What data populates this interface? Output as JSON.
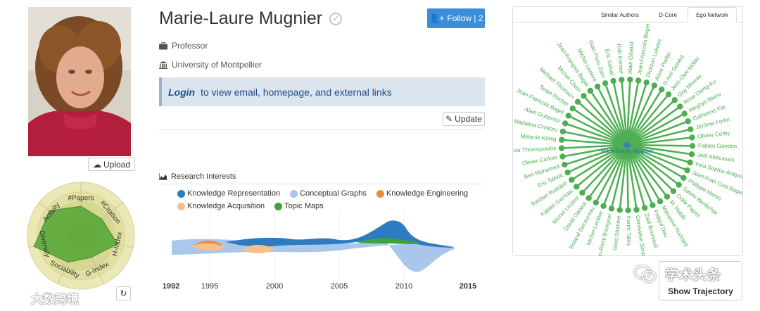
{
  "profile": {
    "name": "Marie-Laure Mugnier",
    "position": "Professor",
    "affiliation": "University of Montpellier",
    "upload_label": "Upload",
    "follow_label": "Follow | 2",
    "login_text": "Login",
    "login_suffix": "to view email, homepage, and external links",
    "update_label": "Update"
  },
  "radar": {
    "axes": [
      "#Papers",
      "#Citation",
      "H-Index",
      "G-Index",
      "Sociability",
      "Diversity",
      "Activity"
    ],
    "values": [
      0.55,
      0.5,
      0.7,
      0.45,
      0.55,
      0.9,
      0.75
    ],
    "fill_color": "#5aa83a"
  },
  "research_interests": {
    "title": "Research Interests",
    "legend": [
      {
        "name": "Knowledge Representation",
        "color": "#2e7bbf"
      },
      {
        "name": "Conceptual Graphs",
        "color": "#a9c6ec"
      },
      {
        "name": "Knowledge Engineering",
        "color": "#ee8b3c"
      },
      {
        "name": "Knowledge Acquisition",
        "color": "#f7bf8a"
      },
      {
        "name": "Topic Maps",
        "color": "#3fa33a"
      }
    ],
    "x_ticks": [
      {
        "label": "1992",
        "bold": true
      },
      {
        "label": "1995",
        "bold": false
      },
      {
        "label": "2000",
        "bold": false
      },
      {
        "label": "2005",
        "bold": false
      },
      {
        "label": "2010",
        "bold": false
      },
      {
        "label": "2015",
        "bold": true
      }
    ]
  },
  "network_panel": {
    "tabs": [
      "Similar Authors",
      "D-Core",
      "Ego Network"
    ],
    "active_tab": "Ego Network",
    "center": "Marie-Laure Mugnier",
    "node_color": "#4caf50",
    "center_color": "#3b7dc4",
    "nodes": [
      "Jean-Francois Baget",
      "Dickson Lukose",
      "Anne Preller",
      "D Anil Genest",
      "Jens-Uwe Möller",
      "Guy Mineau",
      "Rose Dieng-Ku",
      "Meghyn Bienv",
      "Catherine Far",
      "Jérôme Fortin",
      "Olivier Corby",
      "Fabien Gandon",
      "Joël Abécassis",
      "Inria Sophia-Antipolis",
      "Jean-Fran Cois Baget",
      "Philippe Martin",
      "Salem Benferhat",
      "Odile Papini",
      "M. Habib",
      "Marianne Huchard",
      "Frithjof Dau",
      "Ziad Boursouli",
      "Genevieve Simonet",
      "Karim Tabia",
      "Gerd Stumme",
      "Jean-Remi Bourguet",
      "Michel Leclère",
      "Roland Ducournau",
      "David Genest",
      "Michel Leclère",
      "Fabien Garreau",
      "Bastian Rudolph",
      "Eric Salvat",
      "Ben Mohamed",
      "Olivier Carloni",
      "Lou Thomopoulos",
      "Mélanie König",
      "Madalina Croitoru",
      "Alain Gutierrez",
      "Jean-François Baget",
      "Swan Rocher",
      "Michael Thomazo",
      "Michel Chein",
      "Jean-François Baget",
      "Michel Leclère",
      "Gian Piero Zarri",
      "Éric Salvat",
      "Rob Kremer",
      "Alain Gibaud"
    ]
  },
  "watermarks": {
    "left": "大数跨境",
    "right": "学术头条"
  },
  "show_trajectory_label": "Show Trajectory"
}
